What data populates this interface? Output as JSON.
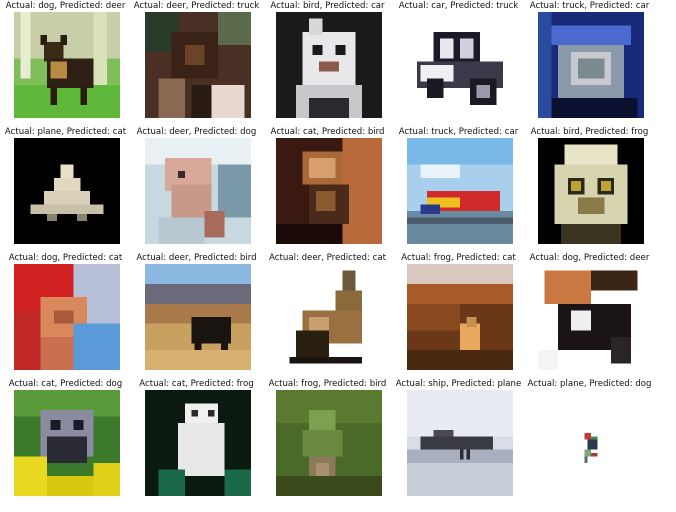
{
  "figure": {
    "panels": [
      {
        "title": "Actual: dog, Predicted: deer"
      },
      {
        "title": "Actual: deer, Predicted: truck"
      },
      {
        "title": "Actual: bird, Predicted: car"
      },
      {
        "title": "Actual: car, Predicted: truck"
      },
      {
        "title": "Actual: truck, Predicted: car"
      },
      {
        "title": "Actual: plane, Predicted: cat"
      },
      {
        "title": "Actual: deer, Predicted: dog"
      },
      {
        "title": "Actual: cat, Predicted: bird"
      },
      {
        "title": "Actual: truck, Predicted: car"
      },
      {
        "title": "Actual: bird, Predicted: frog"
      },
      {
        "title": "Actual: dog, Predicted: cat"
      },
      {
        "title": "Actual: deer, Predicted: bird"
      },
      {
        "title": "Actual: deer, Predicted: cat"
      },
      {
        "title": "Actual: frog, Predicted: cat"
      },
      {
        "title": "Actual: dog, Predicted: deer"
      },
      {
        "title": "Actual: cat, Predicted: dog"
      },
      {
        "title": "Actual: cat, Predicted: frog"
      },
      {
        "title": "Actual: frog, Predicted: bird"
      },
      {
        "title": "Actual: ship, Predicted: plane"
      },
      {
        "title": "Actual: plane, Predicted: dog"
      }
    ]
  }
}
